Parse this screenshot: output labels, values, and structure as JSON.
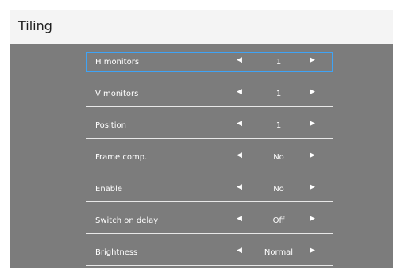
{
  "window": {
    "title": "Tiling"
  },
  "menu": {
    "items": [
      {
        "label": "H monitors",
        "value": "1",
        "left_icon": "triangle-left-icon",
        "right_icon": "triangle-right-icon",
        "selected": true
      },
      {
        "label": "V monitors",
        "value": "1",
        "left_icon": "triangle-left-icon",
        "right_icon": "triangle-right-icon",
        "selected": false
      },
      {
        "label": "Position",
        "value": "1",
        "left_icon": "triangle-left-icon",
        "right_icon": "triangle-right-icon",
        "selected": false
      },
      {
        "label": "Frame comp.",
        "value": "No",
        "left_icon": "triangle-left-icon",
        "right_icon": "triangle-right-icon",
        "selected": false
      },
      {
        "label": "Enable",
        "value": "No",
        "left_icon": "triangle-left-icon",
        "right_icon": "triangle-right-icon",
        "selected": false
      },
      {
        "label": "Switch on delay",
        "value": "Off",
        "left_icon": "triangle-left-icon",
        "right_icon": "triangle-right-icon",
        "selected": false
      },
      {
        "label": "Brightness",
        "value": "Normal",
        "left_icon": "triangle-left-icon",
        "right_icon": "triangle-right-icon",
        "selected": false
      }
    ]
  },
  "colors": {
    "panel_background": "#7c7c7c",
    "header_background": "#f4f4f4",
    "selection_border": "#3fa3f5",
    "text": "#ffffff"
  }
}
